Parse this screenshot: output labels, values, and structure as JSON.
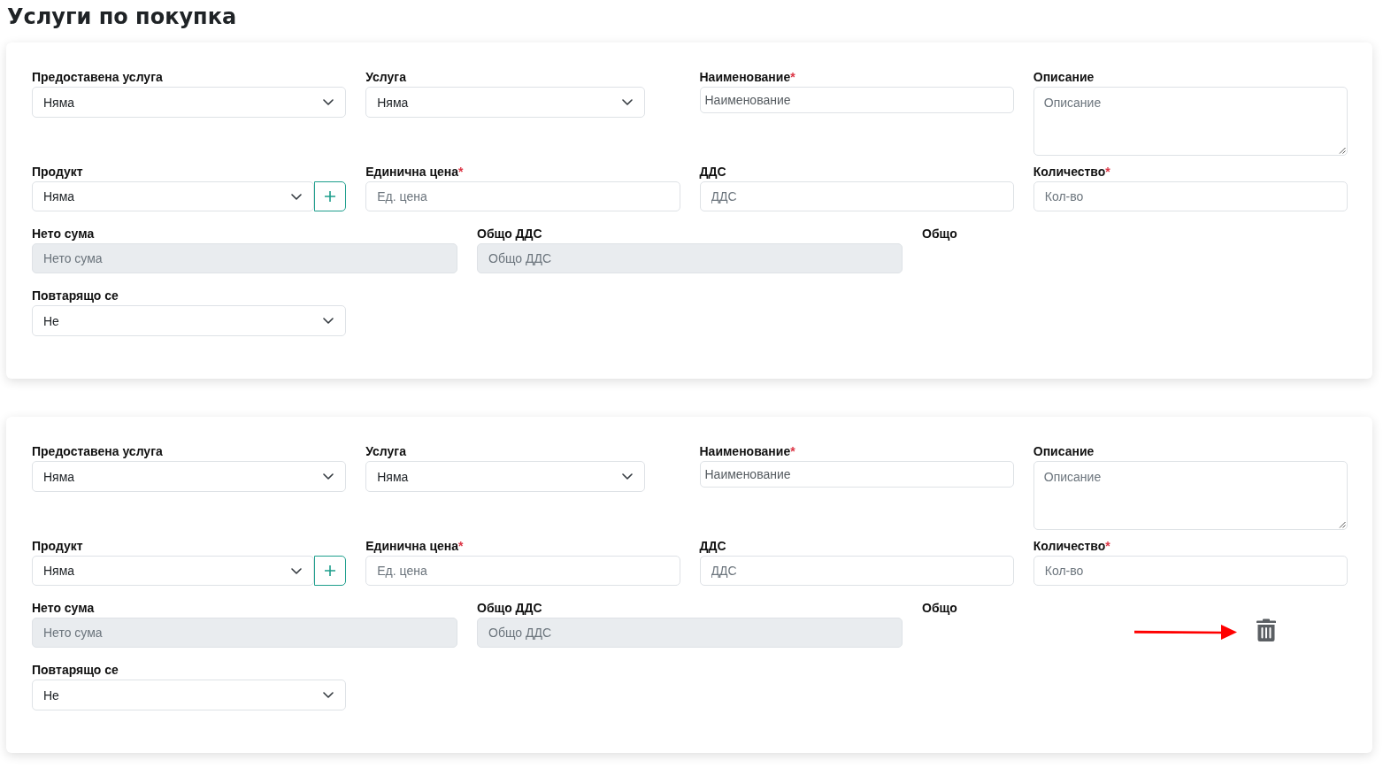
{
  "page": {
    "title": "Услуги по покупка"
  },
  "required_mark": "*",
  "cards": [
    {
      "delete_button": false,
      "pointer_arrow": false,
      "rows": [
        [
          {
            "label": "Предоставена услуга",
            "required": false,
            "kind": "select",
            "value": "Няма"
          },
          {
            "label": "Услуга",
            "required": false,
            "kind": "select",
            "value": "Няма"
          },
          {
            "label": "Наименование",
            "required": true,
            "kind": "compact",
            "placeholder": "Наименование"
          },
          {
            "label": "Описание",
            "required": false,
            "kind": "textarea",
            "placeholder": "Описание"
          }
        ],
        [
          {
            "label": "Продукт",
            "required": false,
            "kind": "select-add",
            "value": "Няма"
          },
          {
            "label": "Единична цена",
            "required": true,
            "kind": "input",
            "placeholder": "Ед. цена"
          },
          {
            "label": "ДДС",
            "required": false,
            "kind": "input",
            "placeholder": "ДДС"
          },
          {
            "label": "Количество",
            "required": true,
            "kind": "input",
            "placeholder": "Кол-во"
          }
        ],
        [
          {
            "label": "Нето сума",
            "required": false,
            "kind": "readonly",
            "placeholder": "Нето сума"
          },
          {
            "label": "Общо ДДС",
            "required": false,
            "kind": "readonly",
            "placeholder": "Общо ДДС"
          },
          {
            "label": "Общо",
            "required": false,
            "kind": "total"
          }
        ],
        [
          {
            "label": "Повтарящо се",
            "required": false,
            "kind": "select",
            "value": "Не"
          }
        ]
      ]
    },
    {
      "delete_button": true,
      "pointer_arrow": true,
      "rows": [
        [
          {
            "label": "Предоставена услуга",
            "required": false,
            "kind": "select",
            "value": "Няма"
          },
          {
            "label": "Услуга",
            "required": false,
            "kind": "select",
            "value": "Няма"
          },
          {
            "label": "Наименование",
            "required": true,
            "kind": "compact",
            "placeholder": "Наименование"
          },
          {
            "label": "Описание",
            "required": false,
            "kind": "textarea",
            "placeholder": "Описание"
          }
        ],
        [
          {
            "label": "Продукт",
            "required": false,
            "kind": "select-add",
            "value": "Няма"
          },
          {
            "label": "Единична цена",
            "required": true,
            "kind": "input",
            "placeholder": "Ед. цена"
          },
          {
            "label": "ДДС",
            "required": false,
            "kind": "input",
            "placeholder": "ДДС"
          },
          {
            "label": "Количество",
            "required": true,
            "kind": "input",
            "placeholder": "Кол-во"
          }
        ],
        [
          {
            "label": "Нето сума",
            "required": false,
            "kind": "readonly",
            "placeholder": "Нето сума"
          },
          {
            "label": "Общо ДДС",
            "required": false,
            "kind": "readonly",
            "placeholder": "Общо ДДС"
          },
          {
            "label": "Общо",
            "required": false,
            "kind": "total"
          }
        ],
        [
          {
            "label": "Повтарящо се",
            "required": false,
            "kind": "select",
            "value": "Не"
          }
        ]
      ]
    }
  ]
}
